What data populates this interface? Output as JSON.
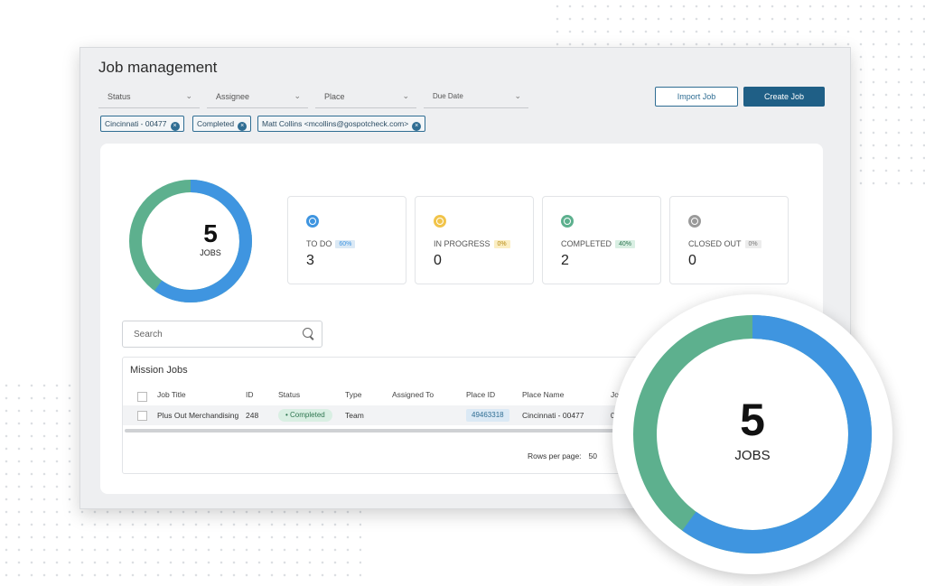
{
  "page": {
    "title": "Job management"
  },
  "filters": [
    {
      "label": "Status"
    },
    {
      "label": "Assignee"
    },
    {
      "label": "Place"
    },
    {
      "label": "Due Date"
    }
  ],
  "actions": {
    "import_label": "Import Job",
    "create_label": "Create Job"
  },
  "chips": [
    {
      "label": "Cincinnati - 00477"
    },
    {
      "label": "Completed"
    },
    {
      "label": "Matt Collins <mcollins@gospotcheck.com>"
    }
  ],
  "summary": {
    "total": "5",
    "total_label": "JOBS",
    "donut": {
      "todo_fraction": 0.6,
      "completed_fraction": 0.4,
      "todo_color": "#3f95e0",
      "completed_color": "#5db08e"
    }
  },
  "stats": [
    {
      "label": "TO DO",
      "percent": "60%",
      "value": "3",
      "icon": "todo-circle-icon",
      "color": "#3f95e0"
    },
    {
      "label": "IN PROGRESS",
      "percent": "0%",
      "value": "0",
      "icon": "in-progress-icon",
      "color": "#f1c44a"
    },
    {
      "label": "COMPLETED",
      "percent": "40%",
      "value": "2",
      "icon": "completed-check-icon",
      "color": "#5db08e"
    },
    {
      "label": "CLOSED OUT",
      "percent": "0%",
      "value": "0",
      "icon": "closed-out-x-icon",
      "color": "#9a9a9a"
    }
  ],
  "search": {
    "placeholder": "Search"
  },
  "table": {
    "title": "Mission Jobs",
    "columns": [
      "Job Title",
      "ID",
      "Status",
      "Type",
      "Assigned To",
      "Place ID",
      "Place Name",
      "Jo"
    ],
    "rows": [
      {
        "job_title": "Plus Out Merchandising",
        "id": "248",
        "status": "Completed",
        "type": "Team",
        "assigned_to": "",
        "place_id": "49463318",
        "place_name": "Cincinnati - 00477",
        "extra": "0!"
      }
    ],
    "rows_per_page_label": "Rows per page:",
    "rows_per_page_value": "50"
  },
  "zoom": {
    "total": "5",
    "label": "JOBS"
  }
}
